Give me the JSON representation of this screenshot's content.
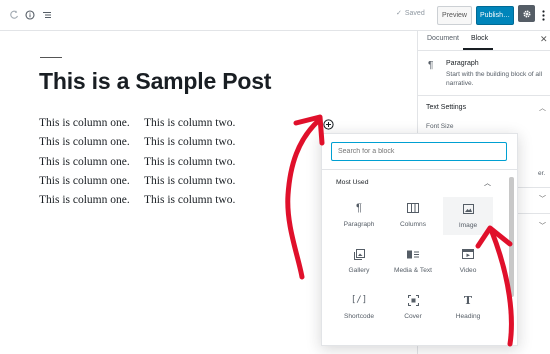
{
  "toolbar": {
    "saved_label": "Saved",
    "preview_label": "Preview",
    "publish_label": "Publish…",
    "icons": [
      "redo-icon",
      "info-icon",
      "outline-icon",
      "gear-icon",
      "more-vertical-icon"
    ]
  },
  "post": {
    "title": "This is a Sample Post",
    "column_one": [
      "This is column one.",
      "This is column one.",
      "This is column one.",
      "This is column one.",
      "This is column one."
    ],
    "column_two": [
      "This is column two.",
      "This is column two.",
      "This is column two.",
      "This is column two.",
      "This is column two."
    ]
  },
  "sidebar": {
    "tabs": [
      "Document",
      "Block"
    ],
    "active_tab": "Block",
    "block_name": "Paragraph",
    "block_description": "Start with the building block of all narrative.",
    "section_text_settings": "Text Settings",
    "font_size_label": "Font Size",
    "partial_text": "er."
  },
  "inserter": {
    "search_placeholder": "Search for a block",
    "panel_title": "Most Used",
    "items": [
      {
        "label": "Paragraph",
        "icon": "paragraph-icon"
      },
      {
        "label": "Columns",
        "icon": "columns-icon"
      },
      {
        "label": "Image",
        "icon": "image-icon"
      },
      {
        "label": "Gallery",
        "icon": "gallery-icon"
      },
      {
        "label": "Media & Text",
        "icon": "media-text-icon"
      },
      {
        "label": "Video",
        "icon": "video-icon"
      },
      {
        "label": "Shortcode",
        "icon": "shortcode-icon"
      },
      {
        "label": "Cover",
        "icon": "cover-icon"
      },
      {
        "label": "Heading",
        "icon": "heading-icon"
      }
    ],
    "highlighted_item": "Image"
  },
  "colors": {
    "publish": "#0085ba",
    "focus": "#00a0d2",
    "annotation_arrow": "#e0102b"
  }
}
